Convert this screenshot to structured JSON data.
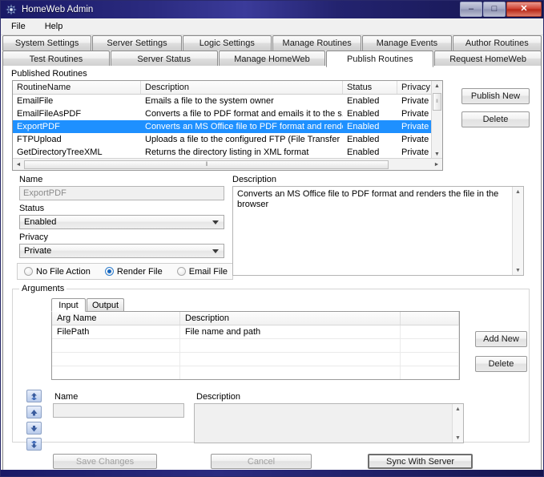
{
  "window": {
    "title": "HomeWeb Admin",
    "icon": "app-icon",
    "controls": {
      "minimize": "–",
      "maximize": "□",
      "close": "✕"
    }
  },
  "menubar": {
    "items": [
      {
        "label": "File"
      },
      {
        "label": "Help"
      }
    ]
  },
  "tabs": {
    "row1": [
      {
        "label": "System Settings",
        "selected": false
      },
      {
        "label": "Server Settings",
        "selected": false
      },
      {
        "label": "Logic Settings",
        "selected": false
      },
      {
        "label": "Manage Routines",
        "selected": false
      },
      {
        "label": "Manage Events",
        "selected": false
      },
      {
        "label": "Author Routines",
        "selected": false
      }
    ],
    "row2": [
      {
        "label": "Test Routines",
        "selected": false
      },
      {
        "label": "Server Status",
        "selected": false
      },
      {
        "label": "Manage HomeWeb",
        "selected": false
      },
      {
        "label": "Publish Routines",
        "selected": true
      },
      {
        "label": "Request HomeWeb",
        "selected": false
      }
    ]
  },
  "published_routines": {
    "label": "Published Routines",
    "columns": [
      "RoutineName",
      "Description",
      "Status",
      "Privacy"
    ],
    "rows": [
      {
        "name": "EmailFile",
        "description": "Emails a file to the system owner",
        "status": "Enabled",
        "privacy": "Private",
        "selected": false
      },
      {
        "name": "EmailFileAsPDF",
        "description": "Converts a file to PDF format and emails it to the s...",
        "status": "Enabled",
        "privacy": "Private",
        "selected": false
      },
      {
        "name": "ExportPDF",
        "description": "Converts an MS Office file to PDF format and rende...",
        "status": "Enabled",
        "privacy": "Private",
        "selected": true
      },
      {
        "name": "FTPUpload",
        "description": "Uploads a file to the configured FTP (File Transfer ...",
        "status": "Enabled",
        "privacy": "Private",
        "selected": false
      },
      {
        "name": "GetDirectoryTreeXML",
        "description": "Returns the directory listing in XML format",
        "status": "Enabled",
        "privacy": "Private",
        "selected": false
      }
    ],
    "scroll": {
      "up_glyph": "▲",
      "down_glyph": "▼",
      "left_glyph": "◄",
      "right_glyph": "►",
      "grip": "‖"
    }
  },
  "side_buttons": {
    "publish_new": "Publish New",
    "delete": "Delete"
  },
  "details": {
    "name_label": "Name",
    "name_value": "ExportPDF",
    "status_label": "Status",
    "status_value": "Enabled",
    "privacy_label": "Privacy",
    "privacy_value": "Private",
    "description_label": "Description",
    "description_value": "Converts an MS Office file to PDF format and renders the file in the browser",
    "file_action": {
      "options": [
        {
          "label": "No File Action",
          "checked": false
        },
        {
          "label": "Render File",
          "checked": true
        },
        {
          "label": "Email File",
          "checked": false
        }
      ]
    }
  },
  "arguments": {
    "group_title": "Arguments",
    "tabs": [
      {
        "label": "Input",
        "selected": true
      },
      {
        "label": "Output",
        "selected": false
      }
    ],
    "columns": [
      "Arg Name",
      "Description"
    ],
    "rows": [
      {
        "name": "FilePath",
        "description": "File name and path"
      },
      {
        "name": "",
        "description": ""
      },
      {
        "name": "",
        "description": ""
      },
      {
        "name": "",
        "description": ""
      }
    ],
    "order_buttons": [
      {
        "name": "move-to-top"
      },
      {
        "name": "move-up"
      },
      {
        "name": "move-down"
      },
      {
        "name": "move-to-bottom"
      }
    ],
    "add_new": "Add New",
    "delete": "Delete",
    "arg_name_label": "Name",
    "arg_name_value": "",
    "arg_description_label": "Description",
    "arg_description_value": ""
  },
  "footer": {
    "save": "Save Changes",
    "cancel": "Cancel",
    "sync": "Sync With Server"
  }
}
